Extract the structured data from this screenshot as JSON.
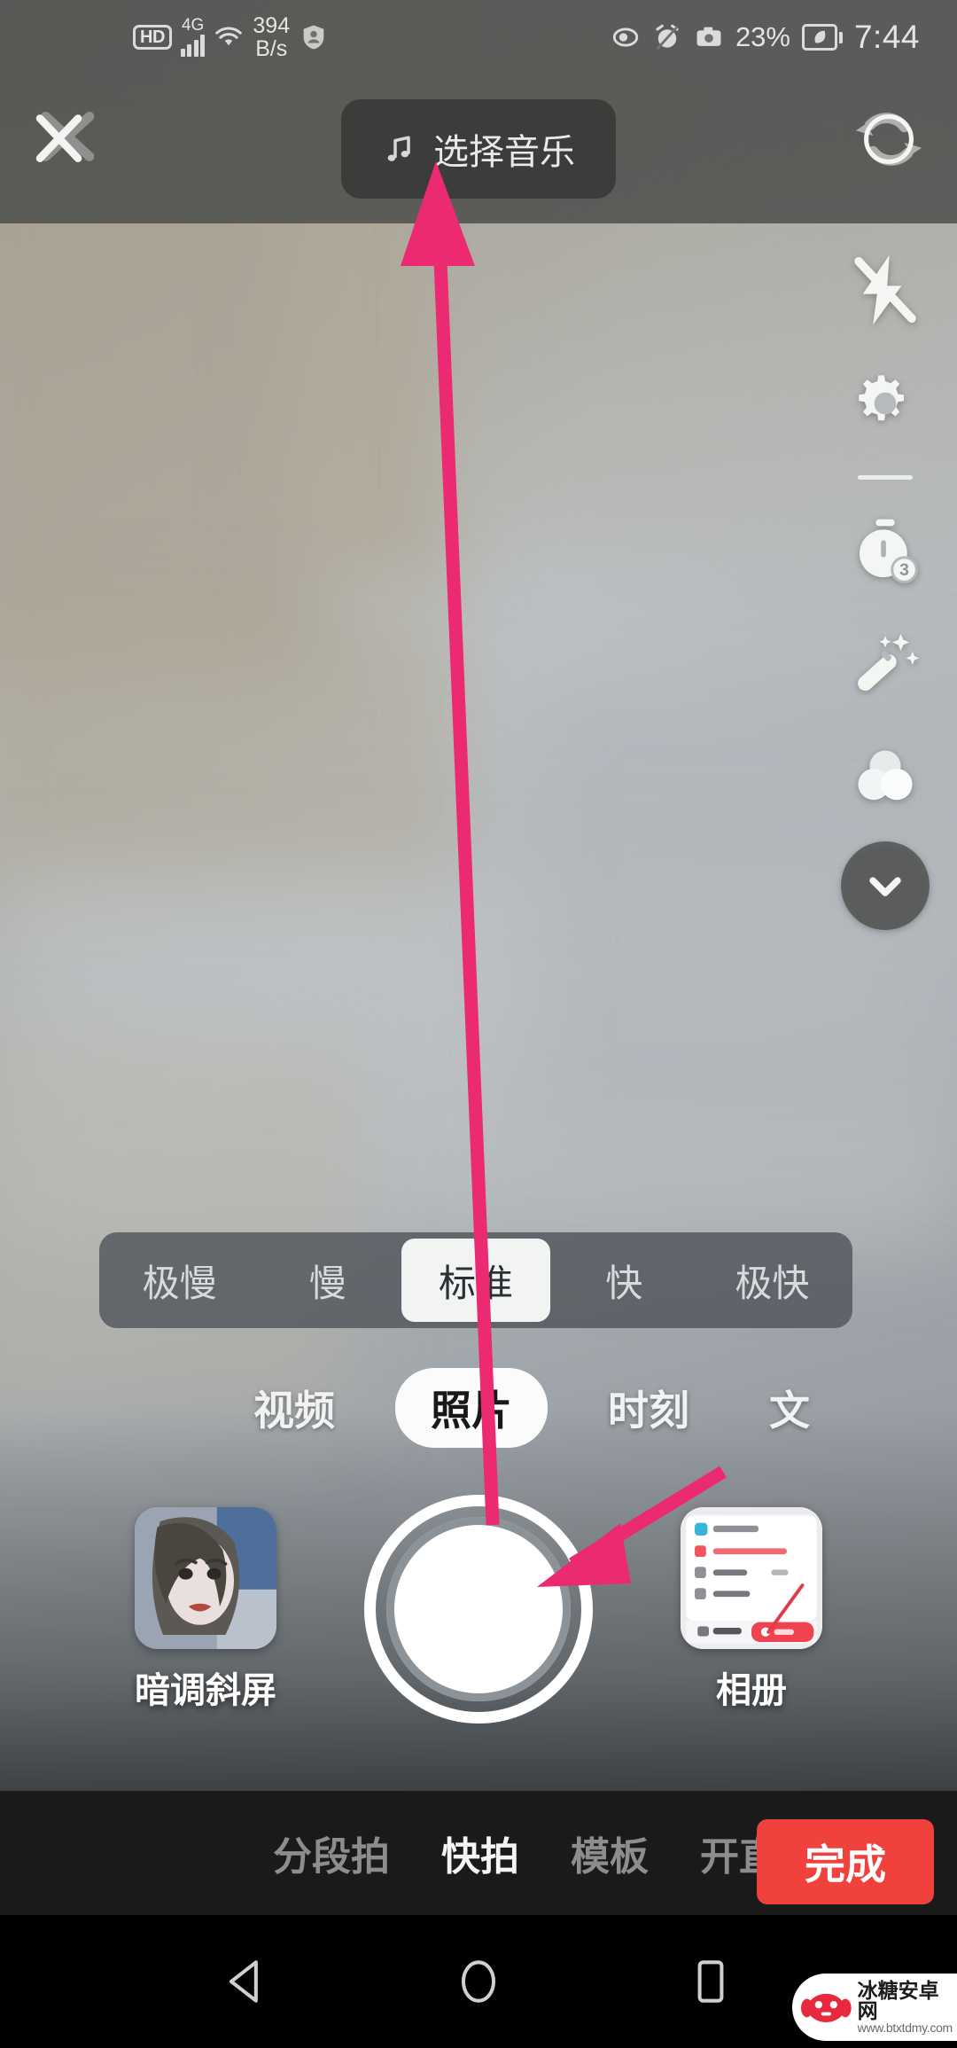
{
  "status_bar": {
    "hd_label": "HD",
    "network_type": "4G",
    "data_speed_value": "394",
    "data_speed_unit": "B/s",
    "battery_percent": "23%",
    "clock": "7:44",
    "icons": [
      "hd-icon",
      "signal-bars-icon",
      "wifi-icon",
      "profile-shield-icon",
      "eye-icon",
      "alarm-icon",
      "camera-icon",
      "battery-icon"
    ]
  },
  "top_bar": {
    "close_label": "✕",
    "music_label": "选择音乐",
    "music_icon": "music-note-icon",
    "flip_icon": "camera-flip-icon"
  },
  "right_rail": {
    "items": [
      {
        "name": "flash-off-icon",
        "label": "闪光关"
      },
      {
        "name": "settings-gear-icon",
        "label": "设置"
      },
      {
        "name": "timer-icon",
        "label": "定时",
        "badge": "3"
      },
      {
        "name": "beauty-wand-icon",
        "label": "美化"
      },
      {
        "name": "filter-circles-icon",
        "label": "滤镜"
      },
      {
        "name": "chevron-down-icon",
        "label": "收起"
      }
    ]
  },
  "speed_selector": {
    "options": [
      "极慢",
      "慢",
      "标准",
      "快",
      "极快"
    ],
    "selected_index": 2
  },
  "mode_tabs": {
    "items": [
      "视频",
      "照片",
      "时刻",
      "文"
    ],
    "selected_index": 1
  },
  "capture_row": {
    "effect_label": "暗调斜屏",
    "album_label": "相册",
    "shutter_name": "shutter-button"
  },
  "bottom_nav": {
    "items": [
      "分段拍",
      "快拍",
      "模板",
      "开直播"
    ],
    "active_index": 1,
    "done_label": "完成"
  },
  "android_nav": {
    "back": "back-triangle-icon",
    "home": "home-circle-icon",
    "recents": "recents-square-icon"
  },
  "watermark": {
    "site_name": "冰糖安卓网",
    "url": "www.btxtdmy.com"
  },
  "annotations": {
    "arrow_color": "#EC2A72",
    "arrow_to_music_label": "指向选择音乐",
    "arrow_to_shutter_label": "指向拍摄按钮"
  },
  "colors": {
    "accent_pink": "#EC2A72",
    "done_red": "#F0413C",
    "bar_dark": "rgba(70,72,70,0.80)",
    "selected_pill": "#F2F3F3"
  }
}
